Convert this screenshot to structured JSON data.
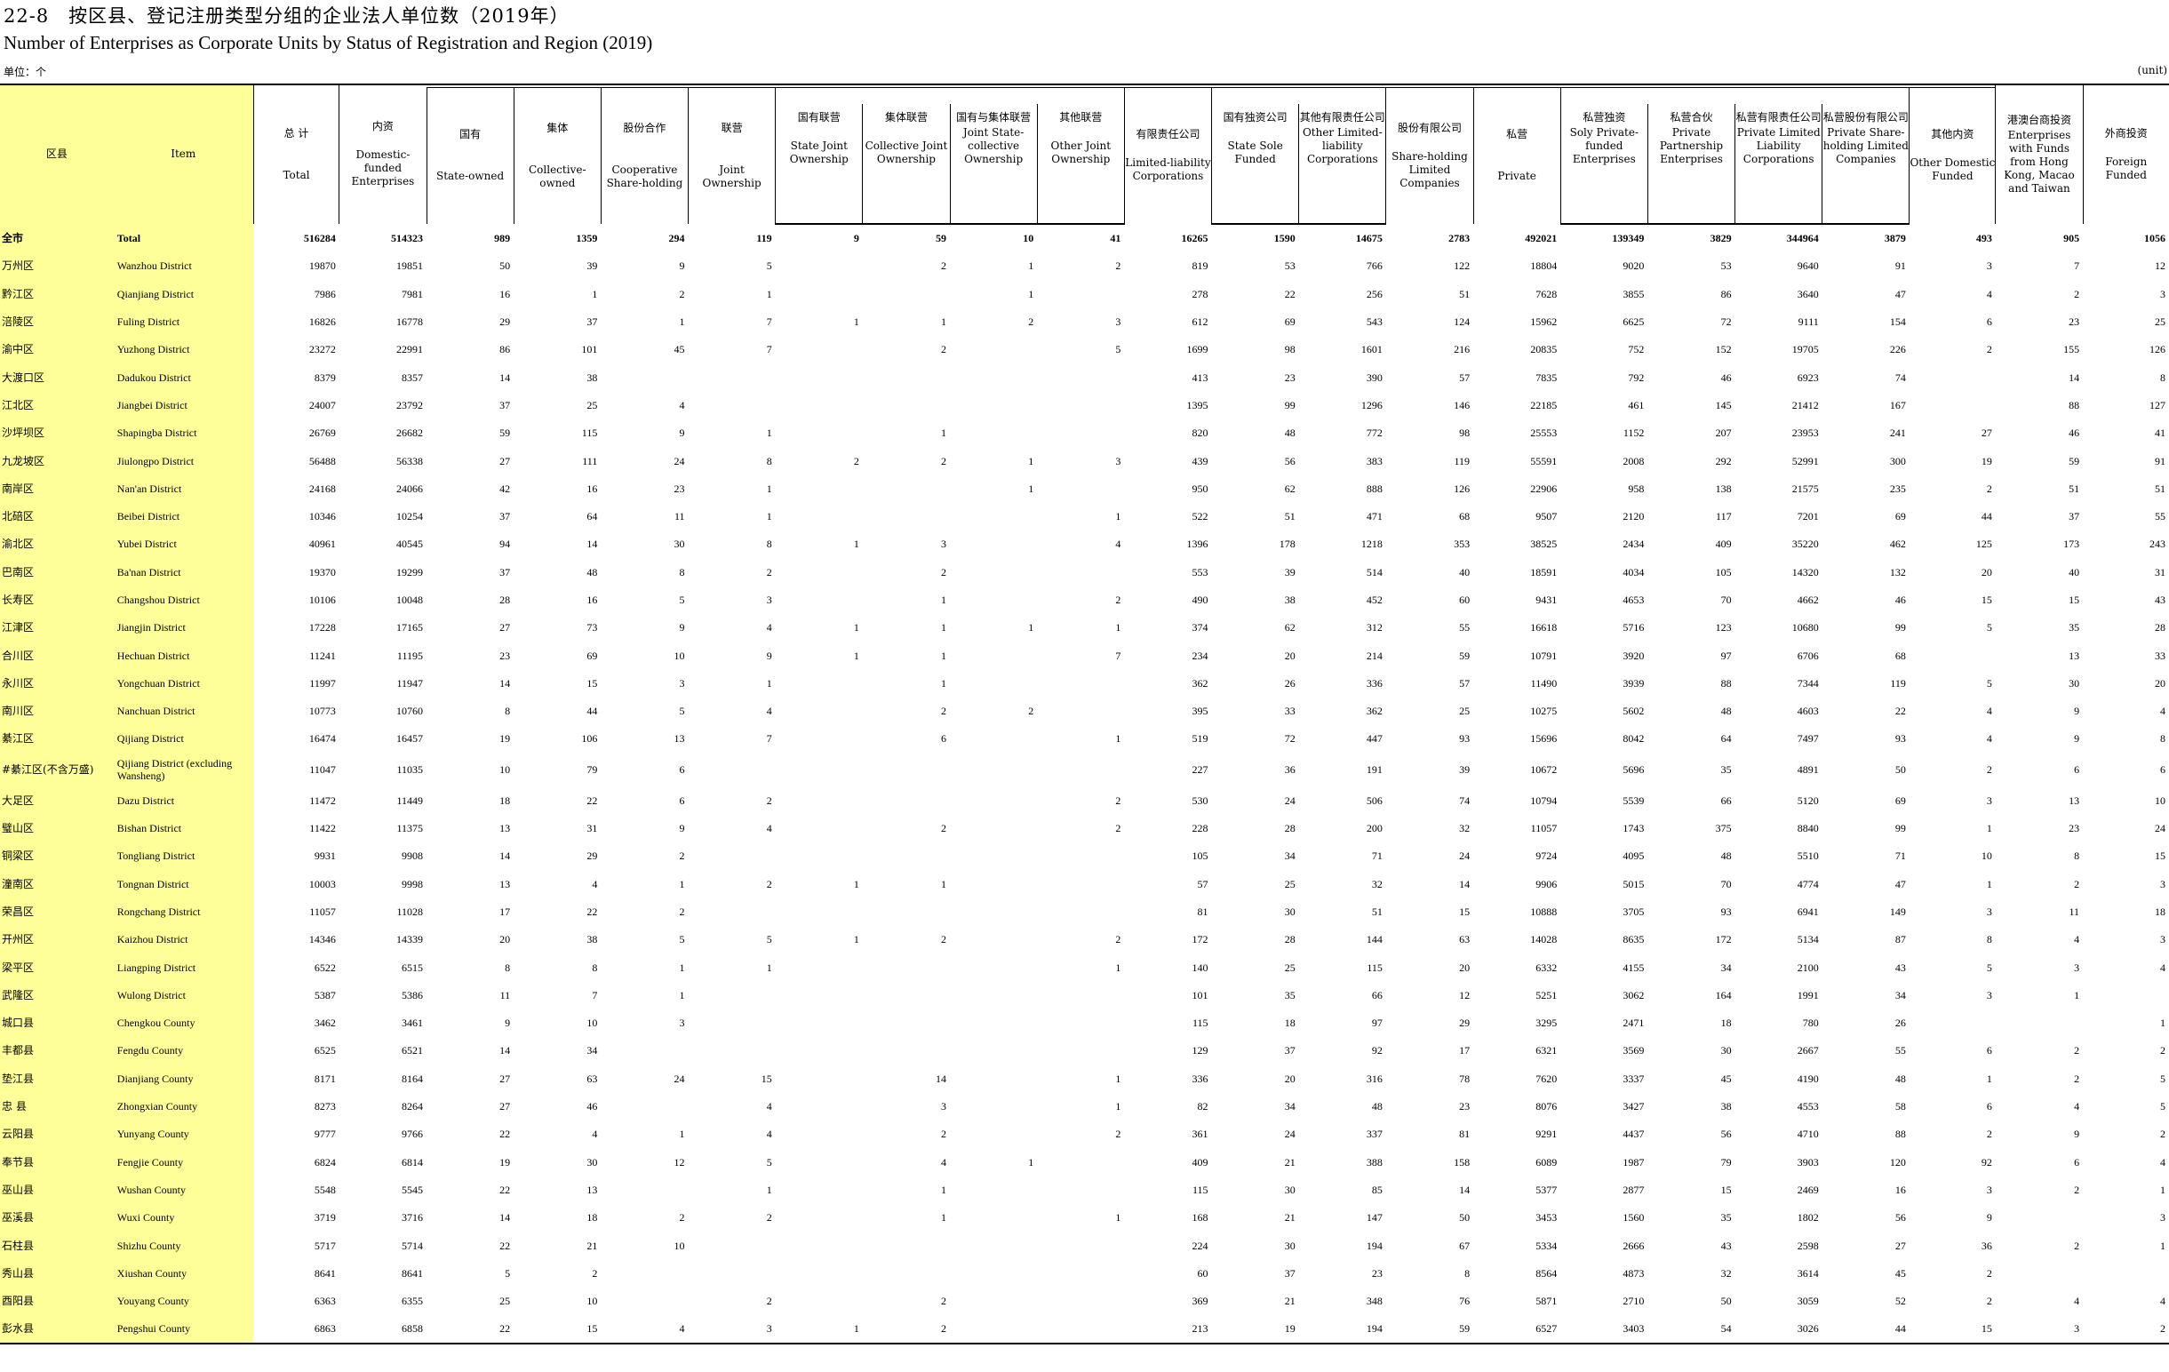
{
  "title_cn": "22-8　按区县、登记注册类型分组的企业法人单位数（2019年）",
  "title_en": "Number of Enterprises as Corporate Units by Status of Registration and Region (2019)",
  "unit_cn": "单位：个",
  "unit_en": "(unit)",
  "header": {
    "region": "区县",
    "item": "Item",
    "total": {
      "cn": "总 计",
      "en": "Total"
    },
    "domestic": {
      "cn": "内资",
      "en": "Domestic-funded Enterprises"
    },
    "state_owned": {
      "cn": "国有",
      "en": "State-owned"
    },
    "collective": {
      "cn": "集体",
      "en": "Collective-owned"
    },
    "coop": {
      "cn": "股份合作",
      "en": "Cooperative Share-holding"
    },
    "joint": {
      "cn": "联营",
      "en": "Joint Ownership"
    },
    "state_joint": {
      "cn": "国有联营",
      "en": "State Joint Ownership"
    },
    "coll_joint": {
      "cn": "集体联营",
      "en": "Collective Joint Ownership"
    },
    "state_coll_joint": {
      "cn": "国有与集体联营",
      "en": "Joint State-collective Ownership"
    },
    "other_joint": {
      "cn": "其他联营",
      "en": "Other Joint Ownership"
    },
    "llc": {
      "cn": "有限责任公司",
      "en": "Limited-liability Corporations"
    },
    "state_sole": {
      "cn": "国有独资公司",
      "en": "State Sole Funded"
    },
    "other_llc": {
      "cn": "其他有限责任公司",
      "en": "Other Limited-liability Corporations"
    },
    "share_ltd": {
      "cn": "股份有限公司",
      "en": "Share-holding Limited Companies"
    },
    "private": {
      "cn": "私营",
      "en": "Private"
    },
    "priv_sole": {
      "cn": "私营独资",
      "en": "Soly Private-funded Enterprises"
    },
    "priv_partner": {
      "cn": "私营合伙",
      "en": "Private Partnership Enterprises"
    },
    "priv_llc": {
      "cn": "私营有限责任公司",
      "en": "Private Limited Liability Corporations"
    },
    "priv_share": {
      "cn": "私营股份有限公司",
      "en": "Private Share-holding Limited Companies"
    },
    "other_domestic": {
      "cn": "其他内资",
      "en": "Other Domestic Funded"
    },
    "hmt": {
      "cn": "港澳台商投资",
      "en": "Enterprises with Funds from Hong Kong, Macao and Taiwan"
    },
    "foreign": {
      "cn": "外商投资",
      "en": "Foreign Funded"
    }
  },
  "rows": [
    {
      "cn": "全市",
      "en": "Total",
      "v": [
        "516284",
        "514323",
        "989",
        "1359",
        "294",
        "119",
        "9",
        "59",
        "10",
        "41",
        "16265",
        "1590",
        "14675",
        "2783",
        "492021",
        "139349",
        "3829",
        "344964",
        "3879",
        "493",
        "905",
        "1056"
      ]
    },
    {
      "cn": "万州区",
      "en": "Wanzhou District",
      "v": [
        "19870",
        "19851",
        "50",
        "39",
        "9",
        "5",
        "",
        "2",
        "1",
        "2",
        "819",
        "53",
        "766",
        "122",
        "18804",
        "9020",
        "53",
        "9640",
        "91",
        "3",
        "7",
        "12"
      ]
    },
    {
      "cn": "黔江区",
      "en": "Qianjiang District",
      "v": [
        "7986",
        "7981",
        "16",
        "1",
        "2",
        "1",
        "",
        "",
        "1",
        "",
        "278",
        "22",
        "256",
        "51",
        "7628",
        "3855",
        "86",
        "3640",
        "47",
        "4",
        "2",
        "3"
      ]
    },
    {
      "cn": "涪陵区",
      "en": "Fuling District",
      "v": [
        "16826",
        "16778",
        "29",
        "37",
        "1",
        "7",
        "1",
        "1",
        "2",
        "3",
        "612",
        "69",
        "543",
        "124",
        "15962",
        "6625",
        "72",
        "9111",
        "154",
        "6",
        "23",
        "25"
      ]
    },
    {
      "cn": "渝中区",
      "en": "Yuzhong District",
      "v": [
        "23272",
        "22991",
        "86",
        "101",
        "45",
        "7",
        "",
        "2",
        "",
        "5",
        "1699",
        "98",
        "1601",
        "216",
        "20835",
        "752",
        "152",
        "19705",
        "226",
        "2",
        "155",
        "126"
      ]
    },
    {
      "cn": "大渡口区",
      "en": "Dadukou District",
      "v": [
        "8379",
        "8357",
        "14",
        "38",
        "",
        "",
        "",
        "",
        "",
        "",
        "413",
        "23",
        "390",
        "57",
        "7835",
        "792",
        "46",
        "6923",
        "74",
        "",
        "14",
        "8"
      ]
    },
    {
      "cn": "江北区",
      "en": "Jiangbei District",
      "v": [
        "24007",
        "23792",
        "37",
        "25",
        "4",
        "",
        "",
        "",
        "",
        "",
        "1395",
        "99",
        "1296",
        "146",
        "22185",
        "461",
        "145",
        "21412",
        "167",
        "",
        "88",
        "127"
      ]
    },
    {
      "cn": "沙坪坝区",
      "en": "Shapingba District",
      "v": [
        "26769",
        "26682",
        "59",
        "115",
        "9",
        "1",
        "",
        "1",
        "",
        "",
        "820",
        "48",
        "772",
        "98",
        "25553",
        "1152",
        "207",
        "23953",
        "241",
        "27",
        "46",
        "41"
      ]
    },
    {
      "cn": "九龙坡区",
      "en": "Jiulongpo District",
      "v": [
        "56488",
        "56338",
        "27",
        "111",
        "24",
        "8",
        "2",
        "2",
        "1",
        "3",
        "439",
        "56",
        "383",
        "119",
        "55591",
        "2008",
        "292",
        "52991",
        "300",
        "19",
        "59",
        "91"
      ]
    },
    {
      "cn": "南岸区",
      "en": "Nan'an District",
      "v": [
        "24168",
        "24066",
        "42",
        "16",
        "23",
        "1",
        "",
        "",
        "1",
        "",
        "950",
        "62",
        "888",
        "126",
        "22906",
        "958",
        "138",
        "21575",
        "235",
        "2",
        "51",
        "51"
      ]
    },
    {
      "cn": "北碚区",
      "en": "Beibei District",
      "v": [
        "10346",
        "10254",
        "37",
        "64",
        "11",
        "1",
        "",
        "",
        "",
        "1",
        "522",
        "51",
        "471",
        "68",
        "9507",
        "2120",
        "117",
        "7201",
        "69",
        "44",
        "37",
        "55"
      ]
    },
    {
      "cn": "渝北区",
      "en": "Yubei District",
      "v": [
        "40961",
        "40545",
        "94",
        "14",
        "30",
        "8",
        "1",
        "3",
        "",
        "4",
        "1396",
        "178",
        "1218",
        "353",
        "38525",
        "2434",
        "409",
        "35220",
        "462",
        "125",
        "173",
        "243"
      ]
    },
    {
      "cn": "巴南区",
      "en": "Ba'nan District",
      "v": [
        "19370",
        "19299",
        "37",
        "48",
        "8",
        "2",
        "",
        "2",
        "",
        "",
        "553",
        "39",
        "514",
        "40",
        "18591",
        "4034",
        "105",
        "14320",
        "132",
        "20",
        "40",
        "31"
      ]
    },
    {
      "cn": "长寿区",
      "en": "Changshou District",
      "v": [
        "10106",
        "10048",
        "28",
        "16",
        "5",
        "3",
        "",
        "1",
        "",
        "2",
        "490",
        "38",
        "452",
        "60",
        "9431",
        "4653",
        "70",
        "4662",
        "46",
        "15",
        "15",
        "43"
      ]
    },
    {
      "cn": "江津区",
      "en": "Jiangjin District",
      "v": [
        "17228",
        "17165",
        "27",
        "73",
        "9",
        "4",
        "1",
        "1",
        "1",
        "1",
        "374",
        "62",
        "312",
        "55",
        "16618",
        "5716",
        "123",
        "10680",
        "99",
        "5",
        "35",
        "28"
      ]
    },
    {
      "cn": "合川区",
      "en": "Hechuan District",
      "v": [
        "11241",
        "11195",
        "23",
        "69",
        "10",
        "9",
        "1",
        "1",
        "",
        "7",
        "234",
        "20",
        "214",
        "59",
        "10791",
        "3920",
        "97",
        "6706",
        "68",
        "",
        "13",
        "33"
      ]
    },
    {
      "cn": "永川区",
      "en": "Yongchuan District",
      "v": [
        "11997",
        "11947",
        "14",
        "15",
        "3",
        "1",
        "",
        "1",
        "",
        "",
        "362",
        "26",
        "336",
        "57",
        "11490",
        "3939",
        "88",
        "7344",
        "119",
        "5",
        "30",
        "20"
      ]
    },
    {
      "cn": "南川区",
      "en": "Nanchuan District",
      "v": [
        "10773",
        "10760",
        "8",
        "44",
        "5",
        "4",
        "",
        "2",
        "2",
        "",
        "395",
        "33",
        "362",
        "25",
        "10275",
        "5602",
        "48",
        "4603",
        "22",
        "4",
        "9",
        "4"
      ]
    },
    {
      "cn": "綦江区",
      "en": "Qijiang District",
      "v": [
        "16474",
        "16457",
        "19",
        "106",
        "13",
        "7",
        "",
        "6",
        "",
        "1",
        "519",
        "72",
        "447",
        "93",
        "15696",
        "8042",
        "64",
        "7497",
        "93",
        "4",
        "9",
        "8"
      ]
    },
    {
      "cn": "#綦江区(不含万盛)",
      "en": "Qijiang District (excluding Wansheng)",
      "v": [
        "11047",
        "11035",
        "10",
        "79",
        "6",
        "",
        "",
        "",
        "",
        "",
        "227",
        "36",
        "191",
        "39",
        "10672",
        "5696",
        "35",
        "4891",
        "50",
        "2",
        "6",
        "6"
      ]
    },
    {
      "cn": "大足区",
      "en": "Dazu District",
      "v": [
        "11472",
        "11449",
        "18",
        "22",
        "6",
        "2",
        "",
        "",
        "",
        "2",
        "530",
        "24",
        "506",
        "74",
        "10794",
        "5539",
        "66",
        "5120",
        "69",
        "3",
        "13",
        "10"
      ]
    },
    {
      "cn": "璧山区",
      "en": "Bishan District",
      "v": [
        "11422",
        "11375",
        "13",
        "31",
        "9",
        "4",
        "",
        "2",
        "",
        "2",
        "228",
        "28",
        "200",
        "32",
        "11057",
        "1743",
        "375",
        "8840",
        "99",
        "1",
        "23",
        "24"
      ]
    },
    {
      "cn": "铜梁区",
      "en": "Tongliang District",
      "v": [
        "9931",
        "9908",
        "14",
        "29",
        "2",
        "",
        "",
        "",
        "",
        "",
        "105",
        "34",
        "71",
        "24",
        "9724",
        "4095",
        "48",
        "5510",
        "71",
        "10",
        "8",
        "15"
      ]
    },
    {
      "cn": "潼南区",
      "en": "Tongnan District",
      "v": [
        "10003",
        "9998",
        "13",
        "4",
        "1",
        "2",
        "1",
        "1",
        "",
        "",
        "57",
        "25",
        "32",
        "14",
        "9906",
        "5015",
        "70",
        "4774",
        "47",
        "1",
        "2",
        "3"
      ]
    },
    {
      "cn": "荣昌区",
      "en": "Rongchang District",
      "v": [
        "11057",
        "11028",
        "17",
        "22",
        "2",
        "",
        "",
        "",
        "",
        "",
        "81",
        "30",
        "51",
        "15",
        "10888",
        "3705",
        "93",
        "6941",
        "149",
        "3",
        "11",
        "18"
      ]
    },
    {
      "cn": "开州区",
      "en": "Kaizhou District",
      "v": [
        "14346",
        "14339",
        "20",
        "38",
        "5",
        "5",
        "1",
        "2",
        "",
        "2",
        "172",
        "28",
        "144",
        "63",
        "14028",
        "8635",
        "172",
        "5134",
        "87",
        "8",
        "4",
        "3"
      ]
    },
    {
      "cn": "梁平区",
      "en": "Liangping District",
      "v": [
        "6522",
        "6515",
        "8",
        "8",
        "1",
        "1",
        "",
        "",
        "",
        "1",
        "140",
        "25",
        "115",
        "20",
        "6332",
        "4155",
        "34",
        "2100",
        "43",
        "5",
        "3",
        "4"
      ]
    },
    {
      "cn": "武隆区",
      "en": "Wulong District",
      "v": [
        "5387",
        "5386",
        "11",
        "7",
        "1",
        "",
        "",
        "",
        "",
        "",
        "101",
        "35",
        "66",
        "12",
        "5251",
        "3062",
        "164",
        "1991",
        "34",
        "3",
        "1",
        ""
      ]
    },
    {
      "cn": "城口县",
      "en": "Chengkou County",
      "v": [
        "3462",
        "3461",
        "9",
        "10",
        "3",
        "",
        "",
        "",
        "",
        "",
        "115",
        "18",
        "97",
        "29",
        "3295",
        "2471",
        "18",
        "780",
        "26",
        "",
        "",
        "1"
      ]
    },
    {
      "cn": "丰都县",
      "en": "Fengdu County",
      "v": [
        "6525",
        "6521",
        "14",
        "34",
        "",
        "",
        "",
        "",
        "",
        "",
        "129",
        "37",
        "92",
        "17",
        "6321",
        "3569",
        "30",
        "2667",
        "55",
        "6",
        "2",
        "2"
      ]
    },
    {
      "cn": "垫江县",
      "en": "Dianjiang County",
      "v": [
        "8171",
        "8164",
        "27",
        "63",
        "24",
        "15",
        "",
        "14",
        "",
        "1",
        "336",
        "20",
        "316",
        "78",
        "7620",
        "3337",
        "45",
        "4190",
        "48",
        "1",
        "2",
        "5"
      ]
    },
    {
      "cn": "忠  县",
      "en": "Zhongxian County",
      "v": [
        "8273",
        "8264",
        "27",
        "46",
        "",
        "4",
        "",
        "3",
        "",
        "1",
        "82",
        "34",
        "48",
        "23",
        "8076",
        "3427",
        "38",
        "4553",
        "58",
        "6",
        "4",
        "5"
      ]
    },
    {
      "cn": "云阳县",
      "en": "Yunyang County",
      "v": [
        "9777",
        "9766",
        "22",
        "4",
        "1",
        "4",
        "",
        "2",
        "",
        "2",
        "361",
        "24",
        "337",
        "81",
        "9291",
        "4437",
        "56",
        "4710",
        "88",
        "2",
        "9",
        "2"
      ]
    },
    {
      "cn": "奉节县",
      "en": "Fengjie County",
      "v": [
        "6824",
        "6814",
        "19",
        "30",
        "12",
        "5",
        "",
        "4",
        "1",
        "",
        "409",
        "21",
        "388",
        "158",
        "6089",
        "1987",
        "79",
        "3903",
        "120",
        "92",
        "6",
        "4"
      ]
    },
    {
      "cn": "巫山县",
      "en": "Wushan County",
      "v": [
        "5548",
        "5545",
        "22",
        "13",
        "",
        "1",
        "",
        "1",
        "",
        "",
        "115",
        "30",
        "85",
        "14",
        "5377",
        "2877",
        "15",
        "2469",
        "16",
        "3",
        "2",
        "1"
      ]
    },
    {
      "cn": "巫溪县",
      "en": "Wuxi County",
      "v": [
        "3719",
        "3716",
        "14",
        "18",
        "2",
        "2",
        "",
        "1",
        "",
        "1",
        "168",
        "21",
        "147",
        "50",
        "3453",
        "1560",
        "35",
        "1802",
        "56",
        "9",
        "",
        "3"
      ]
    },
    {
      "cn": "石柱县",
      "en": "Shizhu County",
      "v": [
        "5717",
        "5714",
        "22",
        "21",
        "10",
        "",
        "",
        "",
        "",
        "",
        "224",
        "30",
        "194",
        "67",
        "5334",
        "2666",
        "43",
        "2598",
        "27",
        "36",
        "2",
        "1"
      ]
    },
    {
      "cn": "秀山县",
      "en": "Xiushan County",
      "v": [
        "8641",
        "8641",
        "5",
        "2",
        "",
        "",
        "",
        "",
        "",
        "",
        "60",
        "37",
        "23",
        "8",
        "8564",
        "4873",
        "32",
        "3614",
        "45",
        "2",
        "",
        ""
      ]
    },
    {
      "cn": "酉阳县",
      "en": "Youyang County",
      "v": [
        "6363",
        "6355",
        "25",
        "10",
        "",
        "2",
        "",
        "2",
        "",
        "",
        "369",
        "21",
        "348",
        "76",
        "5871",
        "2710",
        "50",
        "3059",
        "52",
        "2",
        "4",
        "4"
      ]
    },
    {
      "cn": "彭水县",
      "en": "Pengshui County",
      "v": [
        "6863",
        "6858",
        "22",
        "15",
        "4",
        "3",
        "1",
        "2",
        "",
        "",
        "213",
        "19",
        "194",
        "59",
        "6527",
        "3403",
        "54",
        "3026",
        "44",
        "15",
        "3",
        "2"
      ]
    }
  ]
}
